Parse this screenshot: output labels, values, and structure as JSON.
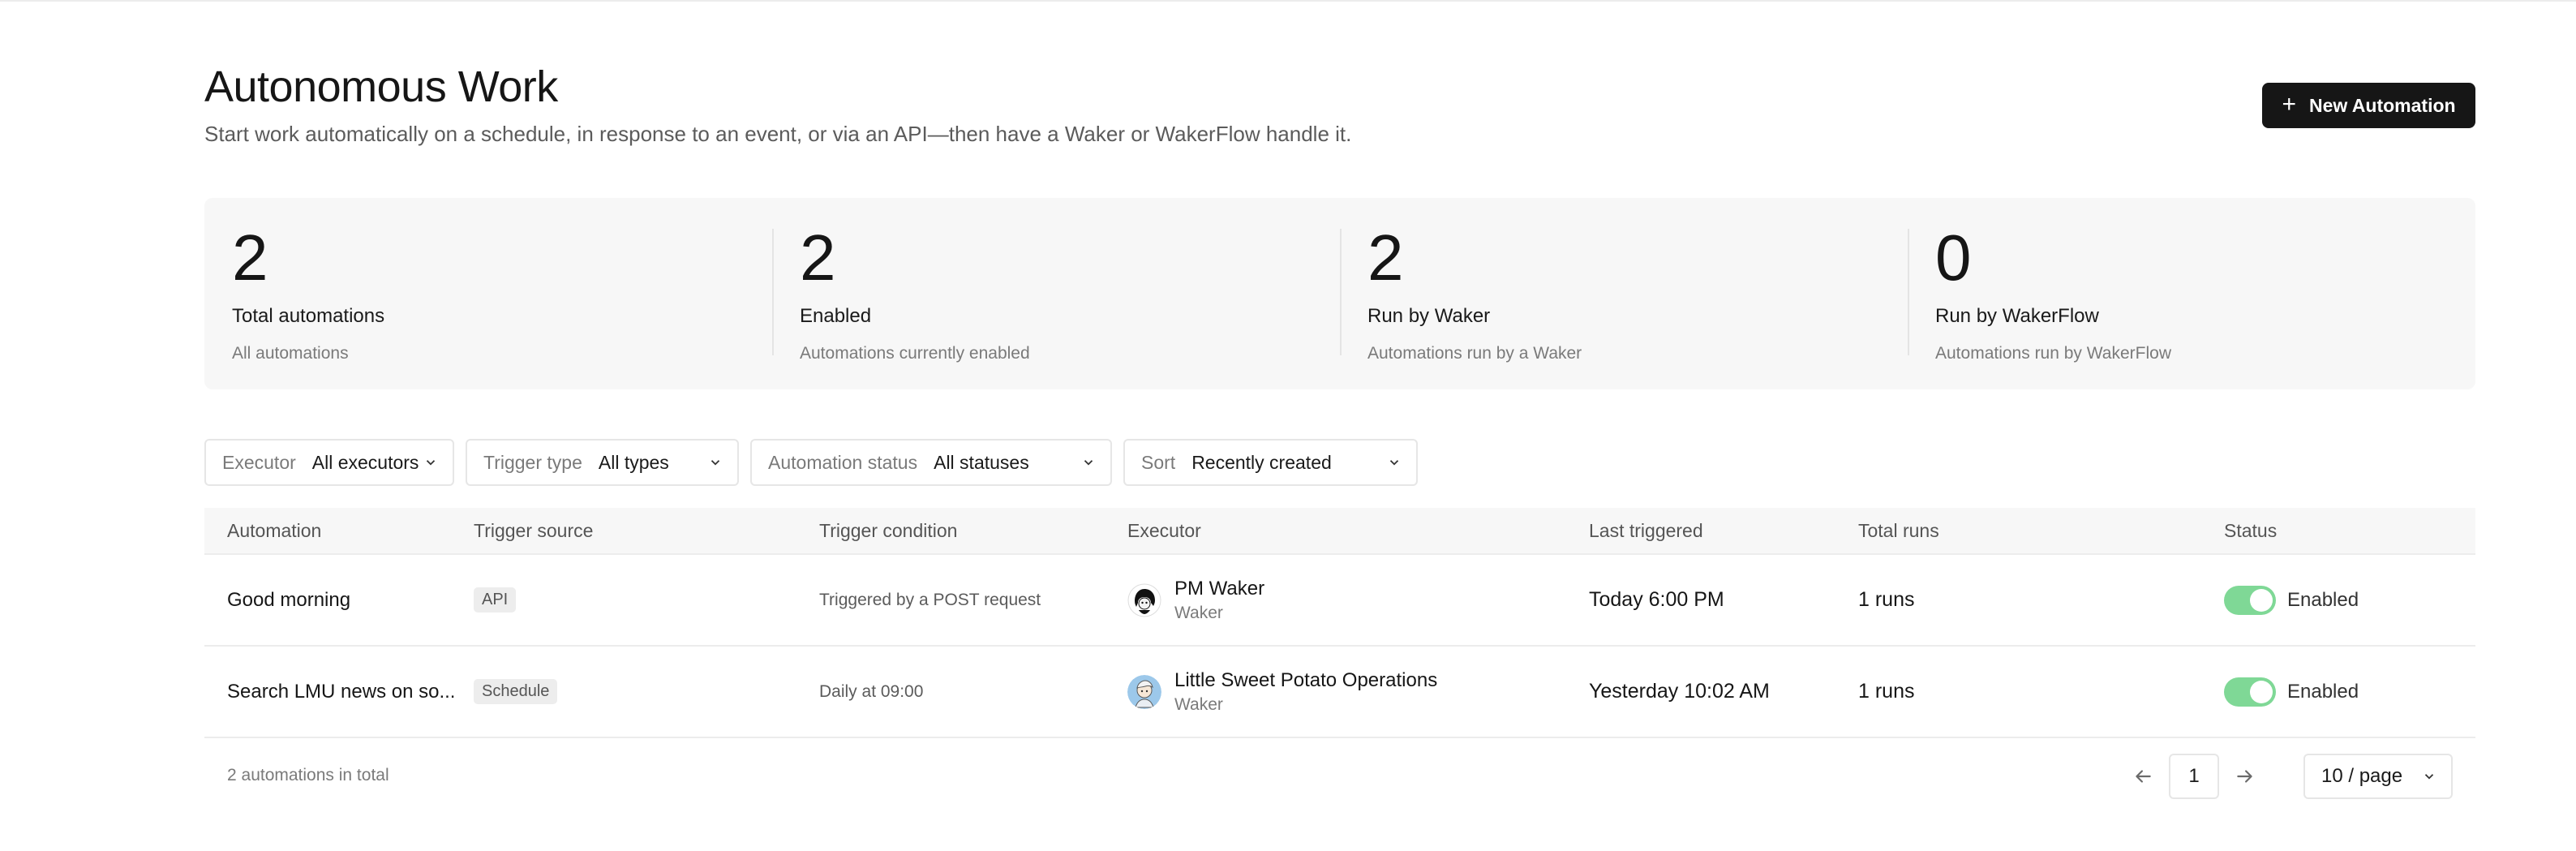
{
  "header": {
    "title": "Autonomous Work",
    "subtitle": "Start work automatically on a schedule, in response to an event, or via an API—then have a Waker or WakerFlow handle it.",
    "new_button": "New Automation"
  },
  "stats": [
    {
      "value": "2",
      "label": "Total automations",
      "desc": "All automations"
    },
    {
      "value": "2",
      "label": "Enabled",
      "desc": "Automations currently enabled"
    },
    {
      "value": "2",
      "label": "Run by Waker",
      "desc": "Automations run by a Waker"
    },
    {
      "value": "0",
      "label": "Run by WakerFlow",
      "desc": "Automations run by WakerFlow"
    }
  ],
  "filters": [
    {
      "label": "Executor",
      "value": "All executors"
    },
    {
      "label": "Trigger type",
      "value": "All types"
    },
    {
      "label": "Automation status",
      "value": "All statuses"
    },
    {
      "label": "Sort",
      "value": "Recently created"
    }
  ],
  "table": {
    "columns": [
      "Automation",
      "Trigger source",
      "Trigger condition",
      "Executor",
      "Last triggered",
      "Total runs",
      "Status"
    ],
    "rows": [
      {
        "automation": "Good morning",
        "source": "API",
        "condition": "Triggered by a POST request",
        "executor_name": "PM Waker",
        "executor_type": "Waker",
        "last": "Today 6:00 PM",
        "runs": "1 runs",
        "status": "Enabled"
      },
      {
        "automation": "Search LMU news on so...",
        "source": "Schedule",
        "condition": "Daily at 09:00",
        "executor_name": "Little Sweet Potato Operations",
        "executor_type": "Waker",
        "last": "Yesterday 10:02 AM",
        "runs": "1 runs",
        "status": "Enabled"
      }
    ]
  },
  "footer": {
    "total": "2 automations in total",
    "page": "1",
    "per_page": "10 / page"
  },
  "colors": {
    "accent": "#161616",
    "toggle_on": "#7fd896"
  },
  "icons": [
    "plus-icon",
    "chevron-down-icon",
    "arrow-left-icon",
    "arrow-right-icon"
  ]
}
